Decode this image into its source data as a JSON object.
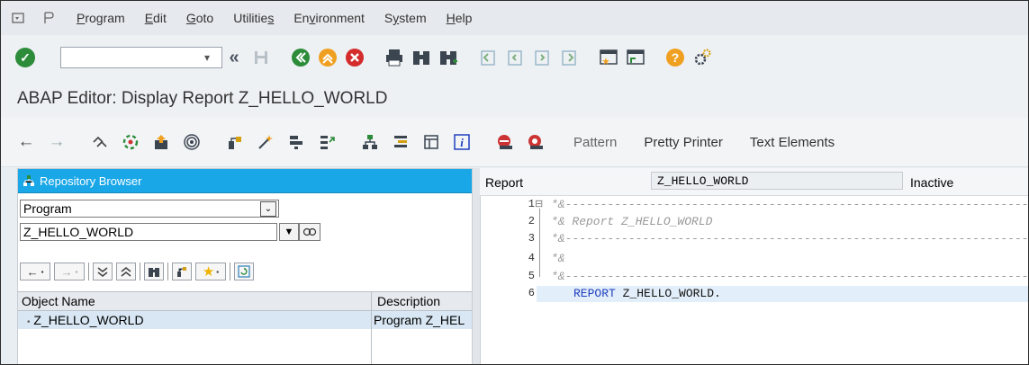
{
  "menubar": {
    "items": [
      {
        "pre": "",
        "u": "P",
        "post": "rogram"
      },
      {
        "pre": "",
        "u": "E",
        "post": "dit"
      },
      {
        "pre": "",
        "u": "G",
        "post": "oto"
      },
      {
        "pre": "Utilitie",
        "u": "s",
        "post": ""
      },
      {
        "pre": "En",
        "u": "v",
        "post": "ironment"
      },
      {
        "pre": "S",
        "u": "y",
        "post": "stem"
      },
      {
        "pre": "",
        "u": "H",
        "post": "elp"
      }
    ]
  },
  "toolbar": {
    "command_field_value": "",
    "icons": [
      "enter-icon",
      "back-icon",
      "save-icon",
      "exit-icon",
      "cancel-icon",
      "stop-icon",
      "print-icon",
      "find-icon",
      "find-next-icon",
      "first-page-icon",
      "previous-page-icon",
      "next-page-icon",
      "last-page-icon",
      "create-session-icon",
      "shortcut-icon",
      "help-icon",
      "customize-layout-icon"
    ]
  },
  "title": "ABAP Editor: Display Report Z_HELLO_WORLD",
  "app_toolbar": {
    "pattern_label": "Pattern",
    "pretty_printer_label": "Pretty Printer",
    "text_elements_label": "Text Elements"
  },
  "repository_browser": {
    "header": "Repository Browser",
    "object_type": "Program",
    "object_name": "Z_HELLO_WORLD",
    "columns": {
      "name": "Object Name",
      "description": "Description"
    },
    "rows": [
      {
        "name": "Z_HELLO_WORLD",
        "description": "Program Z_HEL"
      }
    ]
  },
  "editor": {
    "header_label": "Report",
    "report_name": "Z_HELLO_WORLD",
    "status": "Inactive",
    "lines": [
      {
        "num": "1",
        "text": "*&---------------------------------------------------------------------",
        "type": "comment"
      },
      {
        "num": "2",
        "text": "*& Report Z_HELLO_WORLD",
        "type": "comment"
      },
      {
        "num": "3",
        "text": "*&---------------------------------------------------------------------",
        "type": "comment"
      },
      {
        "num": "4",
        "text": "*&",
        "type": "comment"
      },
      {
        "num": "5",
        "text": "*&---------------------------------------------------------------------",
        "type": "comment"
      },
      {
        "num": "6",
        "keyword": "REPORT",
        "text": " Z_HELLO_WORLD.",
        "type": "code"
      }
    ]
  },
  "colors": {
    "repository_header": "#1aa7e8",
    "ok_button": "#2c8c3a",
    "keyword": "#1f3fbf",
    "comment": "#9a9a9a"
  }
}
